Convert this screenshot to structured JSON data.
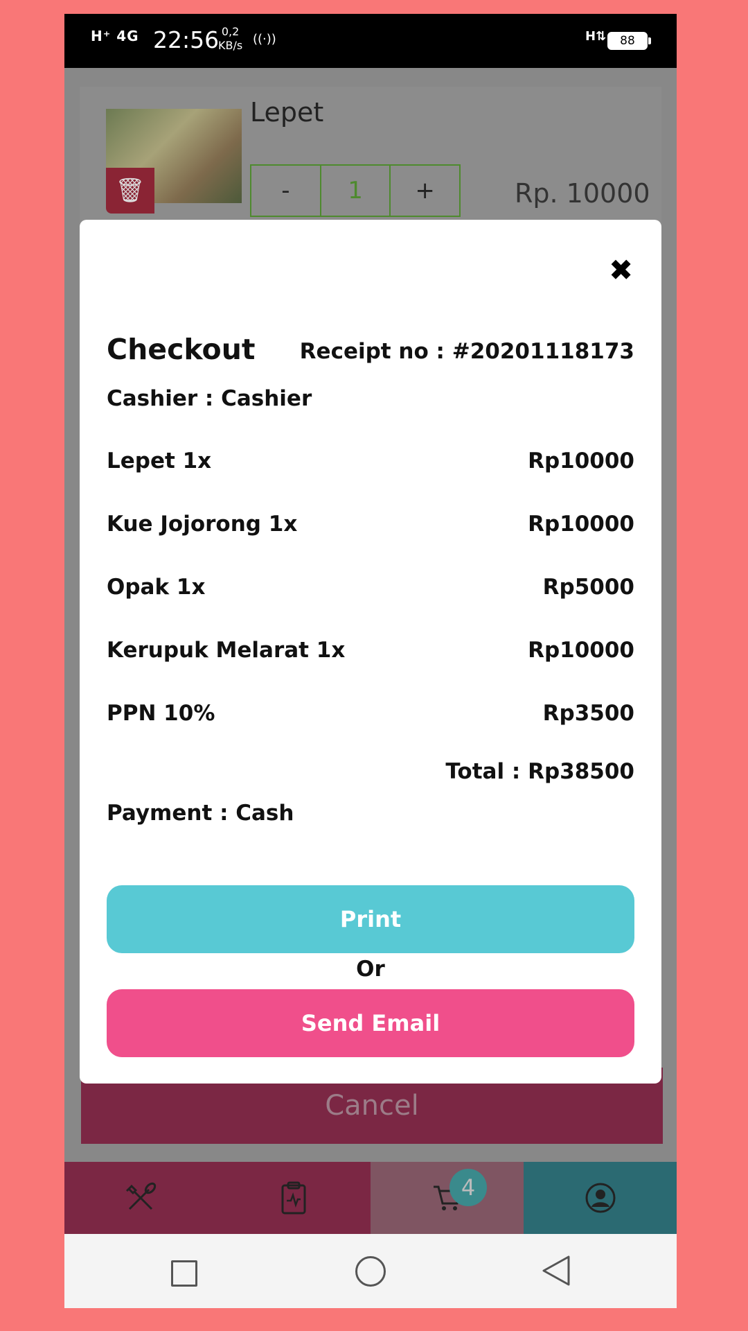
{
  "status_bar": {
    "signal": "H⁺ 4G",
    "time": "22:56",
    "speed_value": "0,2",
    "speed_unit": "KB/s",
    "hotspot": "((·))",
    "network_right": "H⇅",
    "battery": "88"
  },
  "background": {
    "product_name": "Lepet",
    "quantity": "1",
    "minus_label": "-",
    "plus_label": "+",
    "price": "Rp. 10000",
    "cancel_label": "Cancel"
  },
  "bottom_nav": {
    "cart_badge": "4",
    "colors": [
      "#7b2744",
      "#7b2744",
      "#7f5562",
      "#2b6a72"
    ]
  },
  "modal": {
    "close_icon": "✖",
    "title": "Checkout",
    "receipt": "Receipt no : #20201118173",
    "cashier": "Cashier : Cashier",
    "items": [
      {
        "name": "Lepet 1x",
        "price": "Rp10000"
      },
      {
        "name": "Kue Jojorong 1x",
        "price": "Rp10000"
      },
      {
        "name": "Opak 1x",
        "price": "Rp5000"
      },
      {
        "name": "Kerupuk Melarat 1x",
        "price": "Rp10000"
      },
      {
        "name": "PPN 10%",
        "price": "Rp3500"
      }
    ],
    "total": "Total : Rp38500",
    "payment": "Payment : Cash",
    "print_label": "Print",
    "or_label": "Or",
    "email_label": "Send Email"
  },
  "colors": {
    "print_button": "#58c9d4",
    "email_button": "#f04f8b",
    "page_background": "#f97777"
  }
}
